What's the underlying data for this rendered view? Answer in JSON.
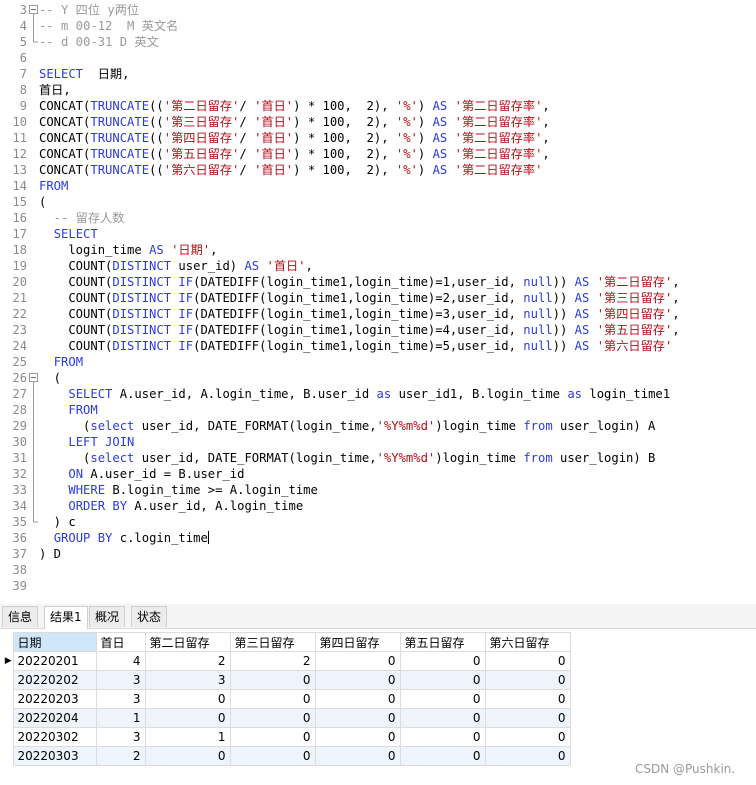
{
  "editor": {
    "lines": [
      {
        "n": "3",
        "fold": "box",
        "parts": [
          [
            "cmt",
            "-- Y 四位 y两位"
          ]
        ]
      },
      {
        "n": "4",
        "fold": "mid",
        "parts": [
          [
            "cmt",
            "-- m 00-12  M 英文名"
          ]
        ]
      },
      {
        "n": "5",
        "fold": "end",
        "parts": [
          [
            "cmt",
            "-- d 00-31 D 英文"
          ]
        ]
      },
      {
        "n": "6",
        "fold": "",
        "parts": []
      },
      {
        "n": "7",
        "fold": "",
        "parts": [
          [
            "kw",
            "SELECT"
          ],
          [
            "",
            "  日期,"
          ]
        ]
      },
      {
        "n": "8",
        "fold": "",
        "parts": [
          [
            "",
            "首日,"
          ]
        ]
      },
      {
        "n": "9",
        "fold": "",
        "parts": [
          [
            "",
            "CONCAT("
          ],
          [
            "fn",
            "TRUNCATE"
          ],
          [
            "",
            "(("
          ],
          [
            "str",
            "'第二日留存'"
          ],
          [
            "",
            "/ "
          ],
          [
            "str",
            "'首日'"
          ],
          [
            "",
            ") * 100,  2), "
          ],
          [
            "str",
            "'%'"
          ],
          [
            "",
            ") "
          ],
          [
            "kw",
            "AS"
          ],
          [
            "",
            " "
          ],
          [
            "str",
            "'第二日留存率'"
          ],
          [
            "",
            ","
          ]
        ]
      },
      {
        "n": "10",
        "fold": "",
        "parts": [
          [
            "",
            "CONCAT("
          ],
          [
            "fn",
            "TRUNCATE"
          ],
          [
            "",
            "(("
          ],
          [
            "str",
            "'第三日留存'"
          ],
          [
            "",
            "/ "
          ],
          [
            "str",
            "'首日'"
          ],
          [
            "",
            ") * 100,  2), "
          ],
          [
            "str",
            "'%'"
          ],
          [
            "",
            ") "
          ],
          [
            "kw",
            "AS"
          ],
          [
            "",
            " "
          ],
          [
            "str",
            "'第二日留存率'"
          ],
          [
            "",
            ","
          ]
        ]
      },
      {
        "n": "11",
        "fold": "",
        "parts": [
          [
            "",
            "CONCAT("
          ],
          [
            "fn",
            "TRUNCATE"
          ],
          [
            "",
            "(("
          ],
          [
            "str",
            "'第四日留存'"
          ],
          [
            "",
            "/ "
          ],
          [
            "str",
            "'首日'"
          ],
          [
            "",
            ") * 100,  2), "
          ],
          [
            "str",
            "'%'"
          ],
          [
            "",
            ") "
          ],
          [
            "kw",
            "AS"
          ],
          [
            "",
            " "
          ],
          [
            "str",
            "'第二日留存率'"
          ],
          [
            "",
            ","
          ]
        ]
      },
      {
        "n": "12",
        "fold": "",
        "parts": [
          [
            "",
            "CONCAT("
          ],
          [
            "fn",
            "TRUNCATE"
          ],
          [
            "",
            "(("
          ],
          [
            "str",
            "'第五日留存'"
          ],
          [
            "",
            "/ "
          ],
          [
            "str",
            "'首日'"
          ],
          [
            "",
            ") * 100,  2), "
          ],
          [
            "str",
            "'%'"
          ],
          [
            "",
            ") "
          ],
          [
            "kw",
            "AS"
          ],
          [
            "",
            " "
          ],
          [
            "str",
            "'第二日留存率'"
          ],
          [
            "",
            ","
          ]
        ]
      },
      {
        "n": "13",
        "fold": "",
        "parts": [
          [
            "",
            "CONCAT("
          ],
          [
            "fn",
            "TRUNCATE"
          ],
          [
            "",
            "(("
          ],
          [
            "str",
            "'第六日留存'"
          ],
          [
            "",
            "/ "
          ],
          [
            "str",
            "'首日'"
          ],
          [
            "",
            ") * 100,  2), "
          ],
          [
            "str",
            "'%'"
          ],
          [
            "",
            ") "
          ],
          [
            "kw",
            "AS"
          ],
          [
            "",
            " "
          ],
          [
            "str",
            "'第二日留存率'"
          ]
        ]
      },
      {
        "n": "14",
        "fold": "",
        "parts": [
          [
            "kw",
            "FROM"
          ]
        ]
      },
      {
        "n": "15",
        "fold": "",
        "parts": [
          [
            "",
            "("
          ]
        ]
      },
      {
        "n": "16",
        "fold": "",
        "parts": [
          [
            "cmt",
            "  -- 留存人数"
          ]
        ]
      },
      {
        "n": "17",
        "fold": "",
        "parts": [
          [
            "",
            "  "
          ],
          [
            "kw",
            "SELECT"
          ]
        ]
      },
      {
        "n": "18",
        "fold": "",
        "parts": [
          [
            "",
            "    login_time "
          ],
          [
            "kw",
            "AS"
          ],
          [
            "",
            " "
          ],
          [
            "str",
            "'日期'"
          ],
          [
            "",
            ","
          ]
        ]
      },
      {
        "n": "19",
        "fold": "",
        "parts": [
          [
            "",
            "    COUNT("
          ],
          [
            "kw",
            "DISTINCT"
          ],
          [
            "",
            " user_id) "
          ],
          [
            "kw",
            "AS"
          ],
          [
            "",
            " "
          ],
          [
            "str",
            "'首日'"
          ],
          [
            "",
            ","
          ]
        ]
      },
      {
        "n": "20",
        "fold": "",
        "parts": [
          [
            "",
            "    COUNT("
          ],
          [
            "kw",
            "DISTINCT"
          ],
          [
            "",
            " "
          ],
          [
            "fn",
            "IF"
          ],
          [
            "",
            "(DATEDIFF(login_time1,login_time)=1,user_id, "
          ],
          [
            "kw",
            "null"
          ],
          [
            "",
            ")) "
          ],
          [
            "kw",
            "AS"
          ],
          [
            "",
            " "
          ],
          [
            "str",
            "'第二日留存'"
          ],
          [
            "",
            ","
          ]
        ]
      },
      {
        "n": "21",
        "fold": "",
        "parts": [
          [
            "",
            "    COUNT("
          ],
          [
            "kw",
            "DISTINCT"
          ],
          [
            "",
            " "
          ],
          [
            "fn",
            "IF"
          ],
          [
            "",
            "(DATEDIFF(login_time1,login_time)=2,user_id, "
          ],
          [
            "kw",
            "null"
          ],
          [
            "",
            ")) "
          ],
          [
            "kw",
            "AS"
          ],
          [
            "",
            " "
          ],
          [
            "str",
            "'第三日留存'"
          ],
          [
            "",
            ","
          ]
        ]
      },
      {
        "n": "22",
        "fold": "",
        "parts": [
          [
            "",
            "    COUNT("
          ],
          [
            "kw",
            "DISTINCT"
          ],
          [
            "",
            " "
          ],
          [
            "fn",
            "IF"
          ],
          [
            "",
            "(DATEDIFF(login_time1,login_time)=3,user_id, "
          ],
          [
            "kw",
            "null"
          ],
          [
            "",
            ")) "
          ],
          [
            "kw",
            "AS"
          ],
          [
            "",
            " "
          ],
          [
            "str",
            "'第四日留存'"
          ],
          [
            "",
            ","
          ]
        ]
      },
      {
        "n": "23",
        "fold": "",
        "parts": [
          [
            "",
            "    COUNT("
          ],
          [
            "kw",
            "DISTINCT"
          ],
          [
            "",
            " "
          ],
          [
            "fn",
            "IF"
          ],
          [
            "",
            "(DATEDIFF(login_time1,login_time)=4,user_id, "
          ],
          [
            "kw",
            "null"
          ],
          [
            "",
            ")) "
          ],
          [
            "kw",
            "AS"
          ],
          [
            "",
            " "
          ],
          [
            "str",
            "'第五日留存'"
          ],
          [
            "",
            ","
          ]
        ]
      },
      {
        "n": "24",
        "fold": "",
        "parts": [
          [
            "",
            "    COUNT("
          ],
          [
            "kw",
            "DISTINCT"
          ],
          [
            "",
            " "
          ],
          [
            "fn",
            "IF"
          ],
          [
            "",
            "(DATEDIFF(login_time1,login_time)=5,user_id, "
          ],
          [
            "kw",
            "null"
          ],
          [
            "",
            ")) "
          ],
          [
            "kw",
            "AS"
          ],
          [
            "",
            " "
          ],
          [
            "str",
            "'第六日留存'"
          ]
        ]
      },
      {
        "n": "25",
        "fold": "",
        "parts": [
          [
            "",
            "  "
          ],
          [
            "kw",
            "FROM"
          ]
        ]
      },
      {
        "n": "26",
        "fold": "box",
        "parts": [
          [
            "",
            "  ("
          ]
        ]
      },
      {
        "n": "27",
        "fold": "mid",
        "parts": [
          [
            "",
            "    "
          ],
          [
            "kw",
            "SELECT"
          ],
          [
            "",
            " A.user_id, A.login_time, B.user_id "
          ],
          [
            "kw",
            "as"
          ],
          [
            "",
            " user_id1, B.login_time "
          ],
          [
            "kw",
            "as"
          ],
          [
            "",
            " login_time1"
          ]
        ]
      },
      {
        "n": "28",
        "fold": "mid",
        "parts": [
          [
            "",
            "    "
          ],
          [
            "kw",
            "FROM"
          ]
        ]
      },
      {
        "n": "29",
        "fold": "mid",
        "parts": [
          [
            "",
            "      ("
          ],
          [
            "kw",
            "select"
          ],
          [
            "",
            " user_id, DATE_FORMAT(login_time,"
          ],
          [
            "str",
            "'%Y%m%d'"
          ],
          [
            "",
            ")login_time "
          ],
          [
            "kw",
            "from"
          ],
          [
            "",
            " user_login) A"
          ]
        ]
      },
      {
        "n": "30",
        "fold": "mid",
        "parts": [
          [
            "",
            "    "
          ],
          [
            "kw",
            "LEFT JOIN"
          ]
        ]
      },
      {
        "n": "31",
        "fold": "mid",
        "parts": [
          [
            "",
            "      ("
          ],
          [
            "kw",
            "select"
          ],
          [
            "",
            " user_id, DATE_FORMAT(login_time,"
          ],
          [
            "str",
            "'%Y%m%d'"
          ],
          [
            "",
            ")login_time "
          ],
          [
            "kw",
            "from"
          ],
          [
            "",
            " user_login) B"
          ]
        ]
      },
      {
        "n": "32",
        "fold": "mid",
        "parts": [
          [
            "",
            "    "
          ],
          [
            "kw",
            "ON"
          ],
          [
            "",
            " A.user_id = B.user_id"
          ]
        ]
      },
      {
        "n": "33",
        "fold": "mid",
        "parts": [
          [
            "",
            "    "
          ],
          [
            "kw",
            "WHERE"
          ],
          [
            "",
            " B.login_time >= A.login_time"
          ]
        ]
      },
      {
        "n": "34",
        "fold": "mid",
        "parts": [
          [
            "",
            "    "
          ],
          [
            "kw",
            "ORDER BY"
          ],
          [
            "",
            " A.user_id, A.login_time"
          ]
        ]
      },
      {
        "n": "35",
        "fold": "end",
        "parts": [
          [
            "",
            "  ) c"
          ]
        ]
      },
      {
        "n": "36",
        "fold": "",
        "parts": [
          [
            "",
            "  "
          ],
          [
            "kw",
            "GROUP BY"
          ],
          [
            "",
            " c.login_time"
          ],
          [
            "caret",
            ""
          ]
        ]
      },
      {
        "n": "37",
        "fold": "",
        "parts": [
          [
            "",
            ") D"
          ]
        ]
      },
      {
        "n": "38",
        "fold": "",
        "parts": []
      },
      {
        "n": "39",
        "fold": "",
        "parts": []
      }
    ]
  },
  "tabs": [
    {
      "label": "信息",
      "active": false
    },
    {
      "label": "结果1",
      "active": true
    },
    {
      "label": "概况",
      "active": false
    },
    {
      "label": "状态",
      "active": false
    }
  ],
  "result": {
    "columns": [
      "日期",
      "首日",
      "第二日留存",
      "第三日留存",
      "第四日留存",
      "第五日留存",
      "第六日留存"
    ],
    "current_row_marker": "▶",
    "rows": [
      [
        "20220201",
        "4",
        "2",
        "2",
        "0",
        "0",
        "0"
      ],
      [
        "20220202",
        "3",
        "3",
        "0",
        "0",
        "0",
        "0"
      ],
      [
        "20220203",
        "3",
        "0",
        "0",
        "0",
        "0",
        "0"
      ],
      [
        "20220204",
        "1",
        "0",
        "0",
        "0",
        "0",
        "0"
      ],
      [
        "20220302",
        "3",
        "1",
        "0",
        "0",
        "0",
        "0"
      ],
      [
        "20220303",
        "2",
        "0",
        "0",
        "0",
        "0",
        "0"
      ]
    ]
  },
  "watermark": "CSDN @Pushkin."
}
